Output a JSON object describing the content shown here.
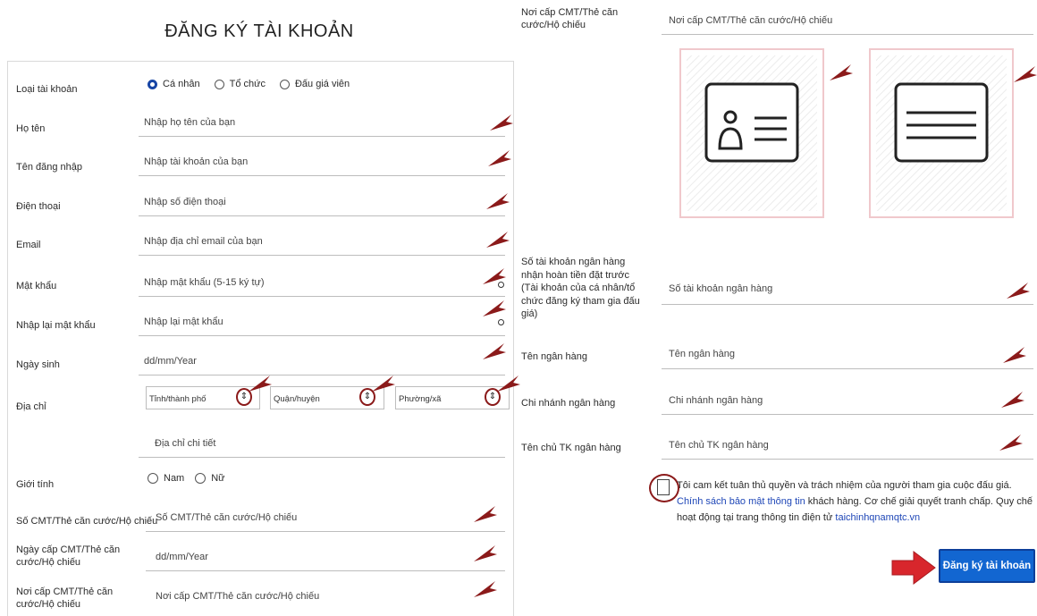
{
  "title": "ĐĂNG KÝ TÀI KHOẢN",
  "account_type": {
    "label": "Loại tài khoản",
    "options": [
      "Cá nhân",
      "Tổ chức",
      "Đấu giá viên"
    ],
    "selected": "Cá nhân"
  },
  "fields": {
    "fullname": {
      "label": "Họ tên",
      "placeholder": "Nhập họ tên của bạn"
    },
    "username": {
      "label": "Tên đăng nhập",
      "placeholder": "Nhập tài khoản của bạn"
    },
    "phone": {
      "label": "Điện thoại",
      "placeholder": "Nhập số điện thoại"
    },
    "email": {
      "label": "Email",
      "placeholder": "Nhập địa chỉ email của bạn"
    },
    "password": {
      "label": "Mật khẩu",
      "placeholder": "Nhập mật khẩu (5-15 ký tự)"
    },
    "password_confirm": {
      "label": "Nhập lại mật khẩu",
      "placeholder": "Nhập lại mật khẩu"
    },
    "birthday": {
      "label": "Ngày sinh",
      "placeholder": "dd/mm/Year"
    },
    "address": {
      "label": "Địa chỉ",
      "province": "Tỉnh/thành phố",
      "district": "Quận/huyện",
      "ward": "Phường/xã",
      "detail_placeholder": "Địa chỉ chi tiết"
    },
    "gender": {
      "label": "Giới tính",
      "options": [
        "Nam",
        "Nữ"
      ]
    },
    "id_number": {
      "label": "Số CMT/Thẻ căn cước/Hộ chiếu",
      "placeholder": "Số CMT/Thẻ căn cước/Hộ chiếu"
    },
    "id_date": {
      "label": "Ngày cấp CMT/Thẻ căn cước/Hộ chiếu",
      "placeholder": "dd/mm/Year"
    },
    "id_place": {
      "label": "Nơi cấp CMT/Thẻ căn cước/Hộ chiếu",
      "placeholder": "Nơi cấp CMT/Thẻ căn cước/Hộ chiếu"
    }
  },
  "right": {
    "id_place": {
      "label": "Nơi cấp CMT/Thẻ căn cước/Hộ chiếu",
      "placeholder": "Nơi cấp CMT/Thẻ căn cước/Hộ chiếu"
    },
    "bank_account": {
      "label": "Số tài khoản ngân hàng nhận hoàn tiền đặt trước (Tài khoản của cá nhân/tổ chức đăng ký tham gia đấu giá)",
      "placeholder": "Số tài khoản ngân hàng"
    },
    "bank_name": {
      "label": "Tên ngân hàng",
      "placeholder": "Tên ngân hàng"
    },
    "bank_branch": {
      "label": "Chi nhánh ngân hàng",
      "placeholder": "Chi nhánh ngân hàng"
    },
    "bank_holder": {
      "label": "Tên chủ TK ngân hàng",
      "placeholder": "Tên chủ TK ngân hàng"
    },
    "agree": {
      "text1": "Tôi cam kết tuân thủ quyền và trách nhiệm của người tham gia cuộc đấu giá.",
      "link1": "Chính sách bảo mật thông tin",
      "text2": "khách hàng. Cơ chế giải quyết tranh chấp. Quy chế hoạt động tại trang thông tin điện tử",
      "link2": "taichinhqnamqtc.vn"
    },
    "submit": "Đăng ký tài khoản"
  },
  "colors": {
    "accent": "#1266d1",
    "arrow": "#8b1a1a",
    "pointer": "#d8262c"
  }
}
